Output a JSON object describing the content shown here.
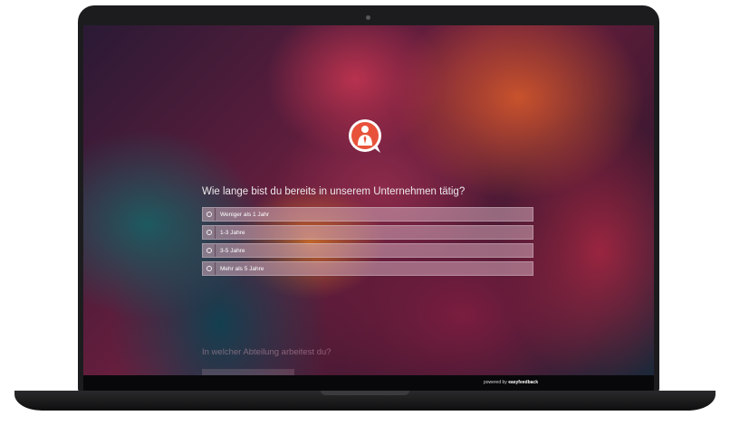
{
  "survey": {
    "question1": "Wie lange bist du bereits in unserem Unternehmen tätig?",
    "options": [
      {
        "label": "Weniger als 1 Jahr"
      },
      {
        "label": "1-3 Jahre"
      },
      {
        "label": "3-5 Jahre"
      },
      {
        "label": "Mehr als 5 Jahre"
      }
    ],
    "question2": "In welcher Abteilung arbeitest du?"
  },
  "footer": {
    "powered_prefix": "powered by",
    "brand": "easyfeedback"
  },
  "icons": {
    "logo": "chat-bubble-person-icon",
    "radio": "radio-circle-icon"
  },
  "colors": {
    "logo_accent": "#e8523a",
    "laptop_body": "#1c1c1e",
    "footer_bar": "#08080a"
  }
}
